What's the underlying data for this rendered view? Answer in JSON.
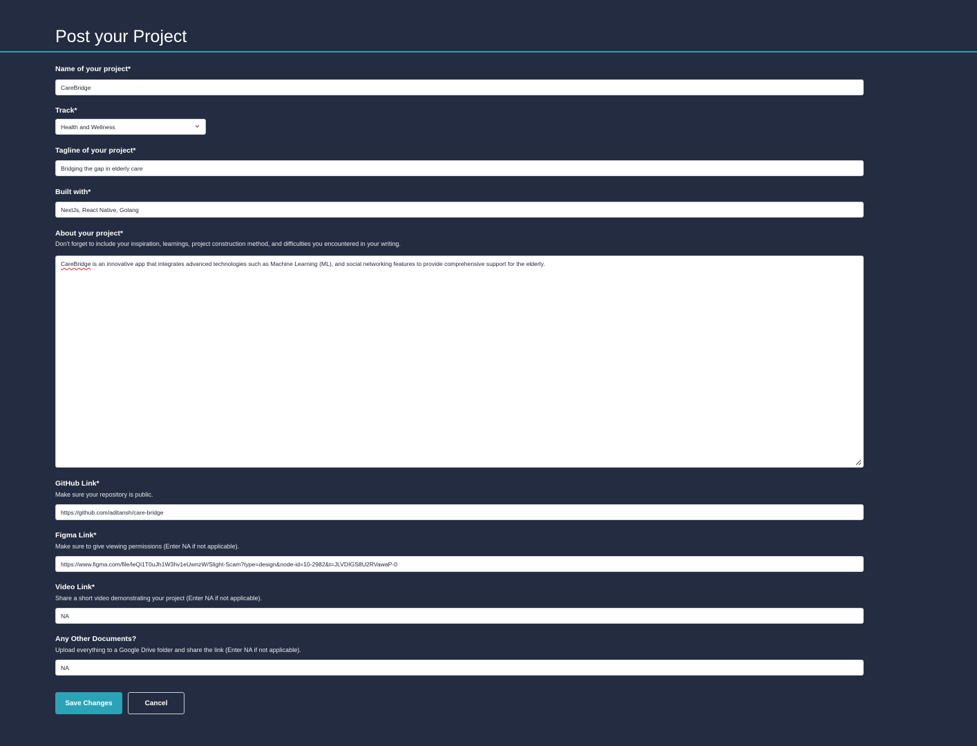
{
  "header": {
    "title": "Post your Project"
  },
  "fields": {
    "name": {
      "label": "Name of your project*",
      "value": "CareBridge"
    },
    "track": {
      "label": "Track*",
      "value": "Health and Wellness"
    },
    "tagline": {
      "label": "Tagline of your project*",
      "value": "Bridging the gap in elderly care"
    },
    "built_with": {
      "label": "Built with*",
      "value": "NextJs, React Native, Golang"
    },
    "about": {
      "label": "About your project*",
      "hint": "Don't forget to include your inspiration, learnings, project construction method, and difficulties you encountered in your writing.",
      "value_word_1": "CareBridge",
      "value_rest": " is an innovative app that integrates advanced technologies such as Machine Learning (ML), and social networking features to provide comprehensive support for the elderly."
    },
    "github": {
      "label": "GitHub Link*",
      "hint": "Make sure your repository is public.",
      "value": "https://github.com/aditansh/care-bridge"
    },
    "figma": {
      "label": "Figma Link*",
      "hint": "Make sure to give viewing permissions (Enter NA if not applicable).",
      "value": "https://www.figma.com/file/leQi1T0uJh1W3hv1eUwnzW/Slight-Scam?type=design&node-id=10-2982&t=JLVDIGS8U2RVawaP-0"
    },
    "video": {
      "label": "Video Link*",
      "hint": "Share a short video demonstrating your project (Enter NA if not applicable).",
      "value": "NA"
    },
    "documents": {
      "label": "Any Other Documents?",
      "hint": "Upload everything to a Google Drive folder and share the link (Enter NA if not applicable).",
      "value": "NA"
    }
  },
  "buttons": {
    "save": "Save Changes",
    "cancel": "Cancel"
  },
  "icons": {
    "track_dropdown": "chevron-down-icon",
    "textarea_resize": "resize-handle-icon"
  },
  "colors": {
    "background": "#232c40",
    "accent": "#2ba3b6",
    "input_background": "#ffffff"
  }
}
